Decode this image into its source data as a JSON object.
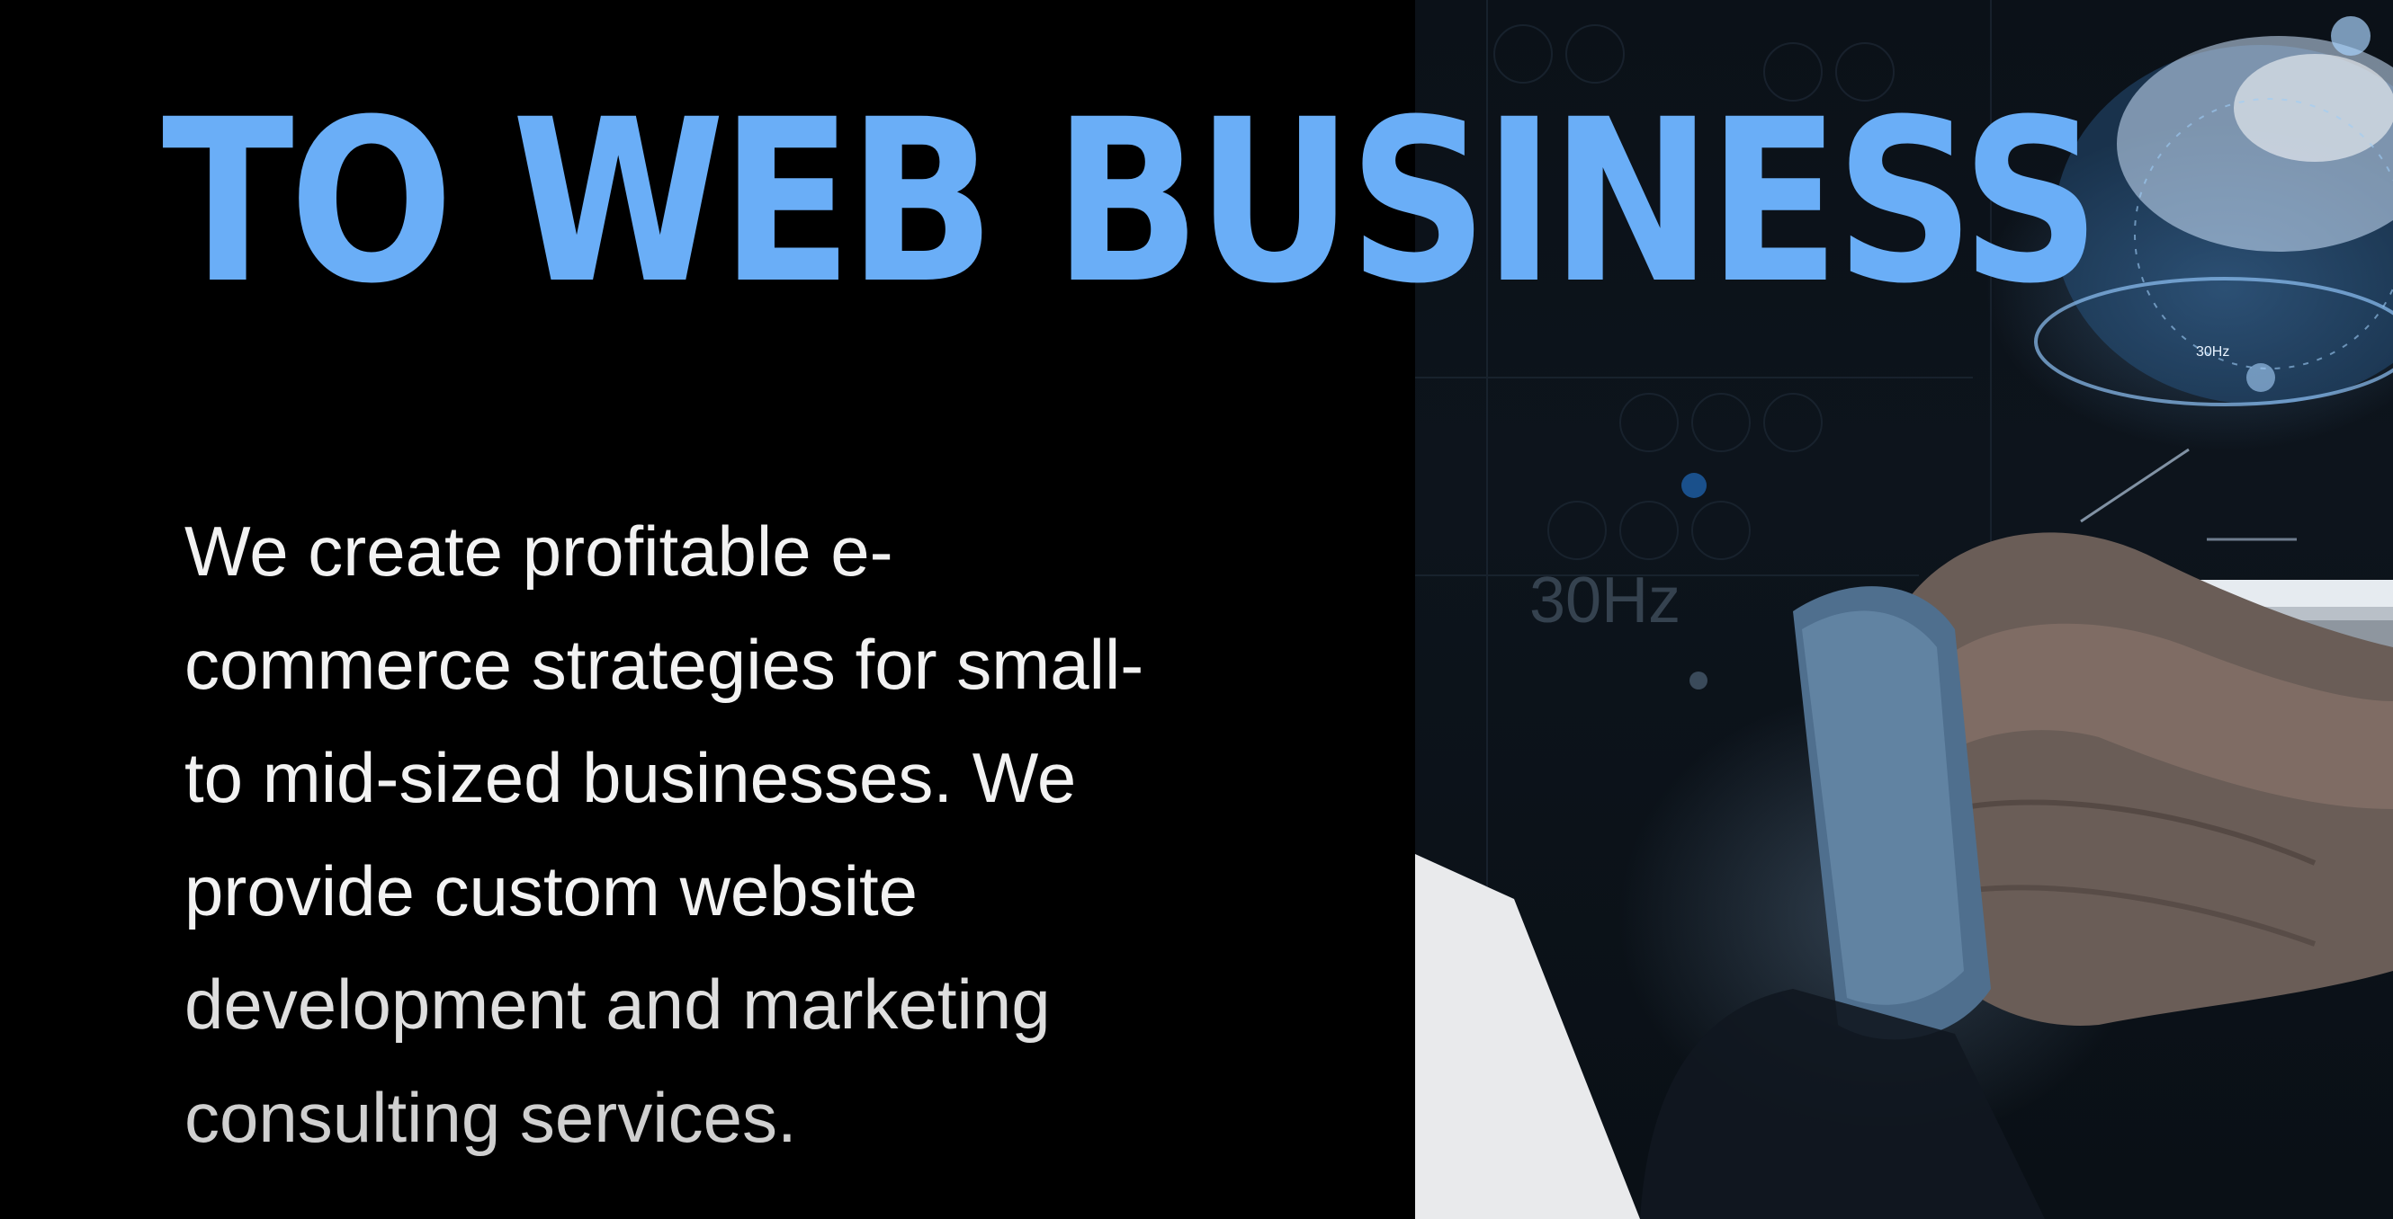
{
  "hero": {
    "headline": "TO WEB BUSINESS",
    "description_lines": [
      "We create profitable e-",
      "commerce strategies for small-",
      "to mid-sized businesses. We",
      "provide custom website",
      "development and marketing",
      "consulting services."
    ],
    "headline_color": "#6aaef7",
    "text_color": "#f2f2f2",
    "background_color": "#000000"
  },
  "photo": {
    "overlay_label": "30Hz",
    "globe_label": "30Hz",
    "subject": "hand holding smartphone with holographic globe"
  }
}
